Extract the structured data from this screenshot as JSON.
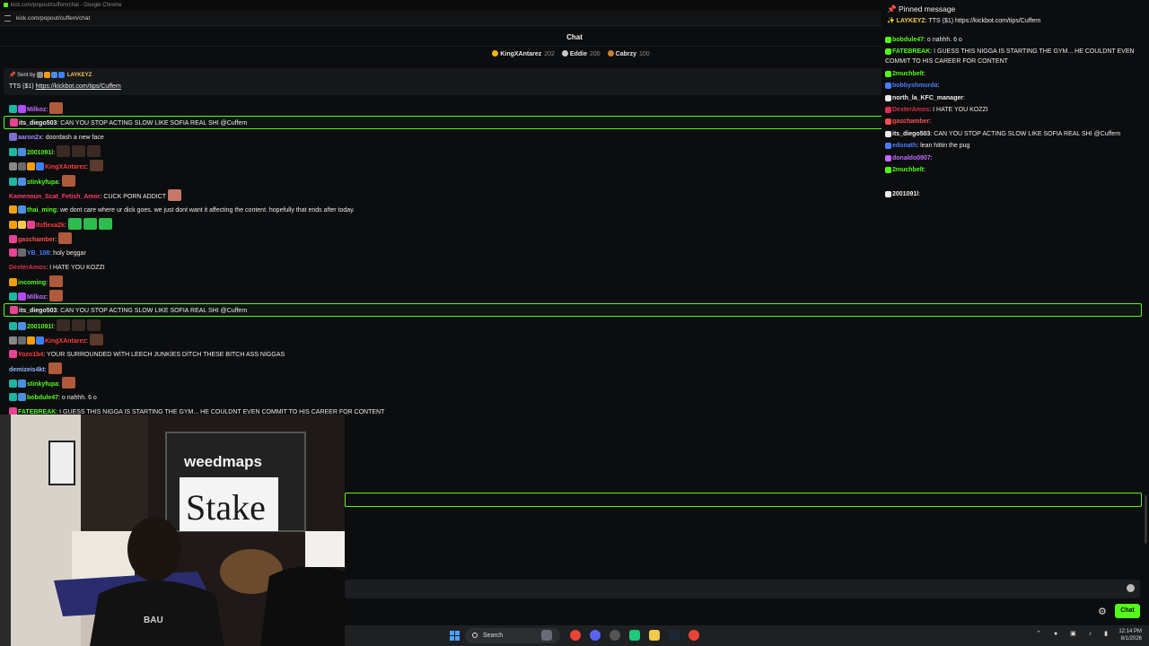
{
  "browser": {
    "title": "kick.com/popout/cuffem/chat - Google Chrome",
    "url": "kick.com/popout/cuffem/chat"
  },
  "header": {
    "title": "Chat",
    "icon": "person-settings-icon"
  },
  "leaderboard": [
    {
      "name": "KingXAntarez",
      "points": "202",
      "color": "#f5b400"
    },
    {
      "name": "Eddie",
      "points": "200",
      "color": "#c8c8c8"
    },
    {
      "name": "Cabrzy",
      "points": "100",
      "color": "#cd7f32"
    }
  ],
  "pinned": {
    "sent_by": "Sent by",
    "user": "LAYKEYZ",
    "text": "TTS ($1)",
    "link": "https://kickbot.com/tips/Cuffem"
  },
  "messages": [
    {
      "user": "Milkoz",
      "color": "#c16bff",
      "text": ":",
      "badges": [
        "#1fb6a0",
        "#b14cff"
      ],
      "emotes": [
        "#b05a3c"
      ],
      "hl": false
    },
    {
      "user": "its_diego503",
      "color": "#eeeeee",
      "text": ": CAN YOU STOP ACTING SLOW LIKE SOFIA REAL SHI @Cuffem",
      "badges": [
        "#e84393"
      ],
      "emotes": [],
      "hl": true
    },
    {
      "user": "aaron2x",
      "color": "#a58bff",
      "text": ": doordash a new face",
      "badges": [
        "#7b6fcf"
      ],
      "emotes": [],
      "hl": false
    },
    {
      "user": "2001091l",
      "color": "#53fc18",
      "text": ":",
      "badges": [
        "#1fb6a0",
        "#4a90e2"
      ],
      "emotes": [
        "#3a2a24",
        "#3a2a24",
        "#3a2a24"
      ],
      "hl": false
    },
    {
      "user": "KingXAntarez",
      "color": "#ff3b3b",
      "text": ":",
      "badges": [
        "#888",
        "#6a6a6a",
        "#f59e0b",
        "#3b82f6"
      ],
      "emotes": [
        "#5a3a2a"
      ],
      "hl": false
    },
    {
      "user": "stinkyfupa",
      "color": "#53fc18",
      "text": ":",
      "badges": [
        "#1fb6a0",
        "#4a90e2"
      ],
      "emotes": [
        "#b05a3c"
      ],
      "hl": false
    },
    {
      "user": "Kamenoun_Scat_Fetish_Amor",
      "color": "#ff3b6b",
      "text": ": CUCK PORN ADDICT",
      "badges": [],
      "emotes": [
        "#c7766a"
      ],
      "hl": false
    },
    {
      "user": "thai_ming",
      "color": "#53fc18",
      "text": ": we dont care where ur dick goes. we just dont want it affecting the content. hopefully that ends after today.",
      "badges": [
        "#f59e0b",
        "#4a90e2"
      ],
      "emotes": [],
      "hl": false
    },
    {
      "user": "Itsflexa2k",
      "color": "#ff3b3b",
      "text": ":",
      "badges": [
        "#f59e0b",
        "#f2c94c",
        "#e84393"
      ],
      "emotes": [
        "#2dbd4f",
        "#2dbd4f",
        "#2dbd4f"
      ],
      "hl": false
    },
    {
      "user": "gaschamber",
      "color": "#ff4d4d",
      "text": ":",
      "badges": [
        "#e84393"
      ],
      "emotes": [
        "#b05a3c"
      ],
      "hl": false
    },
    {
      "user": "YB_108",
      "color": "#4a7dff",
      "text": ": holy beggar",
      "badges": [
        "#e84393",
        "#6a6a6a"
      ],
      "emotes": [],
      "hl": false
    },
    {
      "user": "DexterAmos",
      "color": "#d9304a",
      "text": ": I HATE YOU KOZZI",
      "badges": [],
      "emotes": [],
      "hl": false
    },
    {
      "user": "incoming",
      "color": "#53fc18",
      "text": ":",
      "badges": [
        "#f59e0b"
      ],
      "emotes": [
        "#b05a3c"
      ],
      "hl": false
    },
    {
      "user": "Milkoz",
      "color": "#c16bff",
      "text": ":",
      "badges": [
        "#1fb6a0",
        "#b14cff"
      ],
      "emotes": [
        "#b05a3c"
      ],
      "hl": false
    },
    {
      "user": "its_diego503",
      "color": "#eeeeee",
      "text": ": CAN YOU STOP ACTING SLOW LIKE SOFIA REAL SHI @Cuffem",
      "badges": [
        "#e84393"
      ],
      "emotes": [],
      "hl": true
    },
    {
      "user": "2001091l",
      "color": "#53fc18",
      "text": ":",
      "badges": [
        "#1fb6a0",
        "#4a90e2"
      ],
      "emotes": [
        "#3a2a24",
        "#3a2a24",
        "#3a2a24"
      ],
      "hl": false
    },
    {
      "user": "KingXAntarez",
      "color": "#ff3b3b",
      "text": ":",
      "badges": [
        "#888",
        "#6a6a6a",
        "#f59e0b",
        "#3b82f6"
      ],
      "emotes": [
        "#5a3a2a"
      ],
      "hl": false
    },
    {
      "user": "Yozo1b4",
      "color": "#ff3b3b",
      "text": ": YOUR SURROUNDED WİTH LEECH JUNKİES DİTCH THESE BITCH ASS NİGGAS",
      "badges": [
        "#e84393"
      ],
      "emotes": [],
      "hl": false
    },
    {
      "user": "demizeis4kt",
      "color": "#8fb7ff",
      "text": ":",
      "badges": [],
      "emotes": [
        "#b05a3c"
      ],
      "hl": false
    },
    {
      "user": "stinkyfupa",
      "color": "#53fc18",
      "text": ":",
      "badges": [
        "#1fb6a0",
        "#4a90e2"
      ],
      "emotes": [
        "#b05a3c"
      ],
      "hl": false
    },
    {
      "user": "bobdule47",
      "color": "#53fc18",
      "text": ": o nahhh. 6 o",
      "badges": [
        "#1fb6a0",
        "#4a90e2"
      ],
      "emotes": [],
      "hl": false
    },
    {
      "user": "FATEBREAK",
      "color": "#53fc18",
      "text": ": I GUESS THIS NIGGA IS STARTING THE GYM... HE COULDNT EVEN COMMIT TO HIS CAREER FOR CONTENT",
      "badges": [
        "#e84393"
      ],
      "emotes": [],
      "hl": false
    }
  ],
  "overlay": {
    "heading": "Pinned message",
    "pin_user": "LAYKEYZ",
    "pin_text": ": TTS ($1) https://kickbot.com/tips/Cuffem",
    "messages": [
      {
        "user": "bobdule47",
        "color": "#53fc18",
        "text": ": o nahhh. 6 o"
      },
      {
        "user": "FATEBREAK",
        "color": "#53fc18",
        "text": ": I GUESS THIS NIGGA IS STARTING THE GYM... HE COULDNT EVEN"
      },
      {
        "user": "",
        "color": "#ececec",
        "text": "COMMIT TO HIS CAREER FOR CONTENT"
      },
      {
        "user": "2muchbelt",
        "color": "#53fc18",
        "text": ":"
      },
      {
        "user": "bobbyshmurda",
        "color": "#4a7dff",
        "text": ":"
      },
      {
        "user": "north_la_KFC_manager",
        "color": "#ececec",
        "text": ":"
      },
      {
        "user": "DexterAmos",
        "color": "#d9304a",
        "text": ": I HATE YOU KOZZI"
      },
      {
        "user": "gaschamber",
        "color": "#ff4d4d",
        "text": ":"
      },
      {
        "user": "its_diego503",
        "color": "#ececec",
        "text": ": CAN YOU STOP ACTING SLOW LIKE SOFIA REAL SHI @Cuffem"
      },
      {
        "user": "edonath",
        "color": "#4a7dff",
        "text": ": lean hittin the pug"
      },
      {
        "user": "donaldo0907",
        "color": "#c16bff",
        "text": ":"
      },
      {
        "user": "2muchbelt",
        "color": "#53fc18",
        "text": ":"
      },
      {
        "user": "2001091l",
        "color": "#ececec",
        "text": ":"
      }
    ]
  },
  "camera": {
    "banner_brand": "weedmaps",
    "banner_sponsor": "Stake",
    "shirt_text": "BAU"
  },
  "input": {
    "placeholder": "",
    "chat_button": "Chat"
  },
  "taskbar": {
    "search_label": "Search",
    "time": "12:14 PM",
    "date": "8/1/2026"
  }
}
